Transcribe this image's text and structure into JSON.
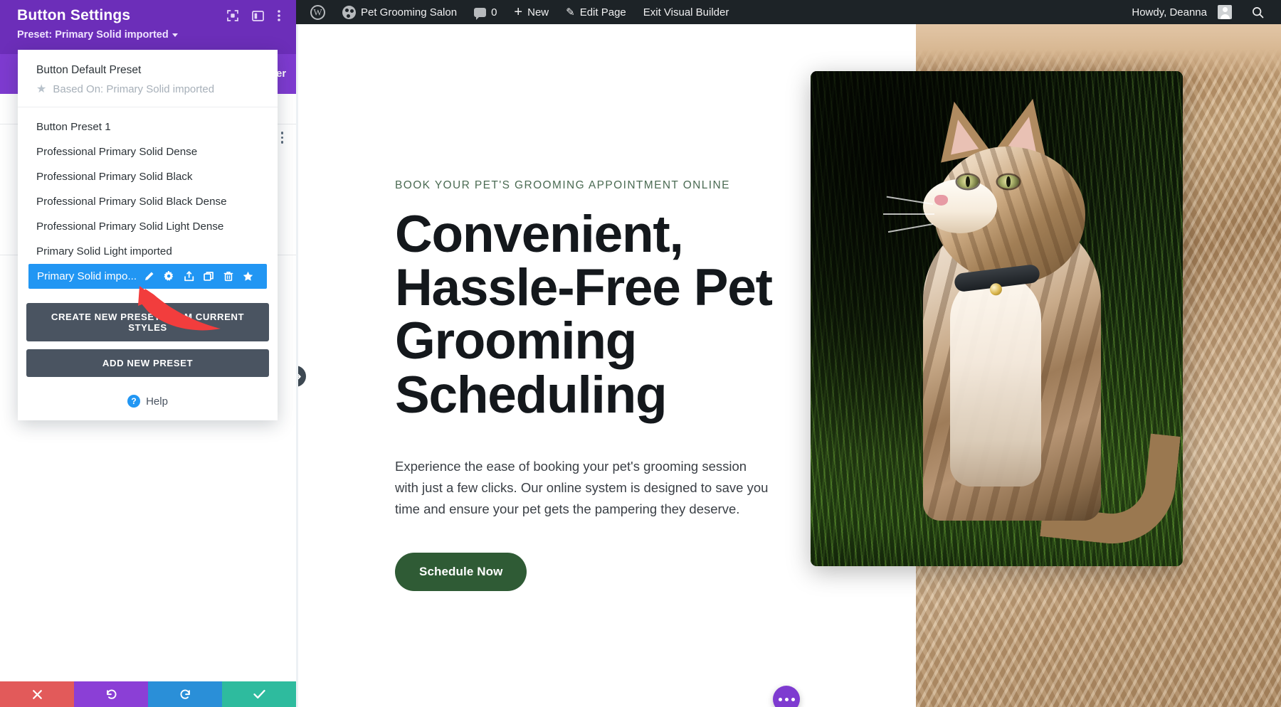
{
  "admin_bar": {
    "wp_logo": "wordpress-logo",
    "site_name": "Pet Grooming Salon",
    "comment_count": "0",
    "new_label": "New",
    "edit_page_label": "Edit Page",
    "exit_builder_label": "Exit Visual Builder",
    "howdy": "Howdy, Deanna",
    "search_icon": "search-icon",
    "bg_color": "#1d2327"
  },
  "settings_panel": {
    "title": "Button Settings",
    "preset_label": "Preset: Primary Solid imported",
    "header_color": "#6c2eb9",
    "header_icons": [
      {
        "name": "focus-target-icon"
      },
      {
        "name": "layout-panel-icon"
      },
      {
        "name": "vertical-dots-icon"
      }
    ],
    "tab_label": "er",
    "dropdown": {
      "default_preset_title": "Button Default Preset",
      "based_on_label": "Based On: Primary Solid imported",
      "items": [
        {
          "label": "Button Preset 1",
          "selected": false
        },
        {
          "label": "Professional Primary Solid Dense",
          "selected": false
        },
        {
          "label": "Professional Primary Solid Black",
          "selected": false
        },
        {
          "label": "Professional Primary Solid Black Dense",
          "selected": false
        },
        {
          "label": "Professional Primary Solid Light Dense",
          "selected": false
        },
        {
          "label": "Primary Solid Light imported",
          "selected": false
        }
      ],
      "selected_item": {
        "label": "Primary Solid impo...",
        "highlight_color": "#2196f3",
        "actions": [
          {
            "name": "edit-pencil-icon"
          },
          {
            "name": "gear-icon"
          },
          {
            "name": "export-icon"
          },
          {
            "name": "duplicate-icon"
          },
          {
            "name": "trash-icon"
          },
          {
            "name": "star-icon"
          }
        ]
      },
      "create_preset_button": "CREATE NEW PRESET FROM CURRENT STYLES",
      "add_preset_button": "ADD NEW PRESET",
      "help_label": "Help"
    },
    "actions": [
      {
        "name": "discard-button",
        "icon": "✕",
        "color": "#e25a5a"
      },
      {
        "name": "undo-button",
        "icon": "↺",
        "color": "#8b3fd6"
      },
      {
        "name": "redo-button",
        "icon": "↻",
        "color": "#2a8fd8"
      },
      {
        "name": "save-button",
        "icon": "✓",
        "color": "#2ebb9e"
      }
    ]
  },
  "page": {
    "eyebrow": "BOOK YOUR PET'S GROOMING APPOINTMENT ONLINE",
    "heading": "Convenient, Hassle-Free Pet Grooming Scheduling",
    "paragraph": "Experience the ease of booking your pet's grooming session with just a few clicks. Our online system is designed to save you time and ensure your pet gets the pampering they deserve.",
    "cta_label": "Schedule Now",
    "cta_color": "#2f5b35",
    "eyebrow_color": "#4b6b53",
    "image_alt": "cat-in-grass-photo"
  },
  "floating": {
    "fab_name": "builder-menu-fab",
    "fab_color": "#7e3bd0",
    "drag_handle_name": "panel-resize-handle"
  }
}
